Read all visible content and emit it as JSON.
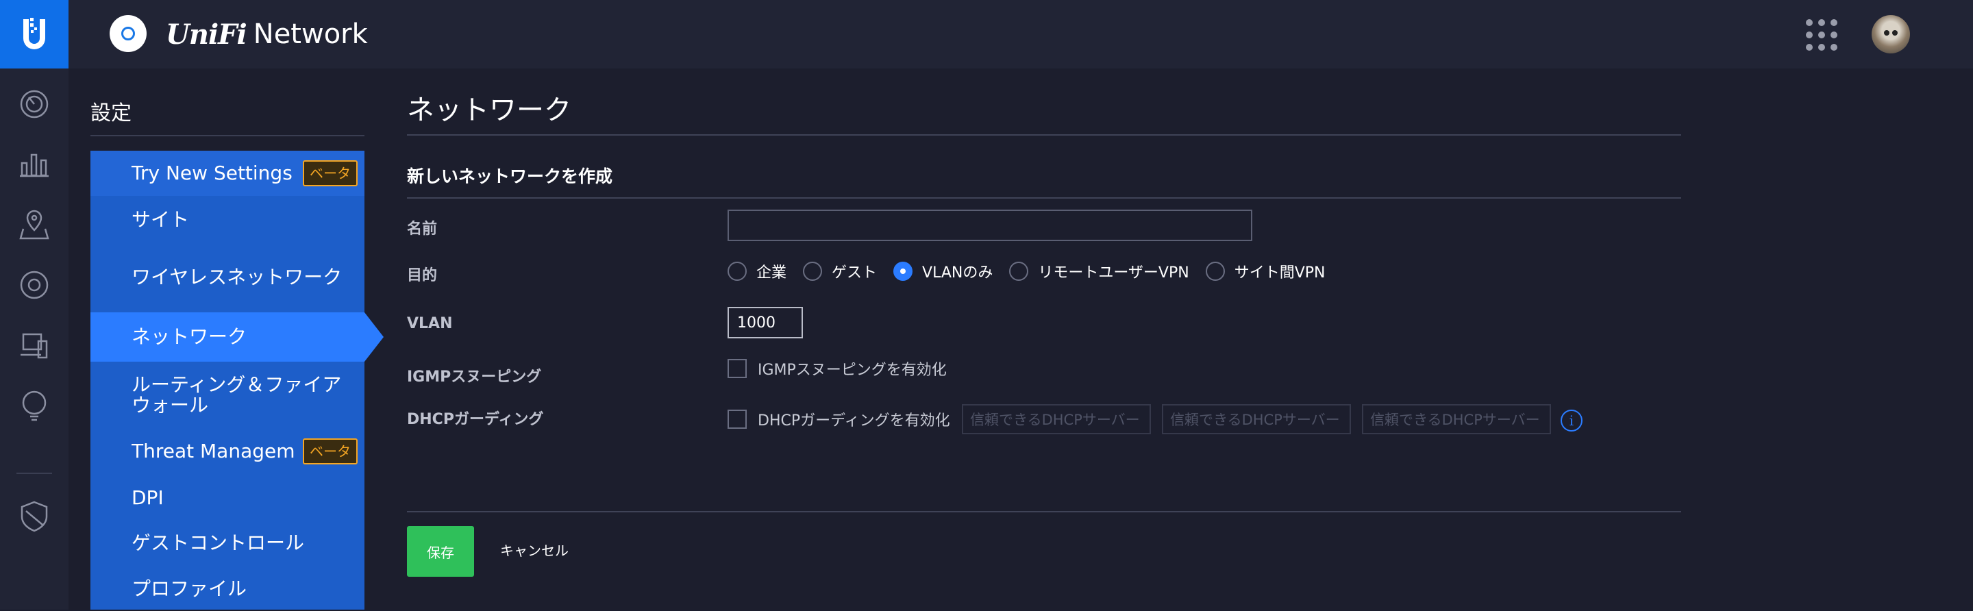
{
  "brand": {
    "name_stylized": "UniFi",
    "product": "Network"
  },
  "sidebar": {
    "title": "設定",
    "items": [
      {
        "label": "Try New Settings",
        "badge": "ベータ"
      },
      {
        "label": "サイト"
      },
      {
        "label": "ワイヤレスネットワーク"
      },
      {
        "label": "ネットワーク"
      },
      {
        "label": "ルーティング＆ファイアウォール"
      },
      {
        "label": "Threat Management",
        "badge": "ベータ"
      },
      {
        "label": "DPI"
      },
      {
        "label": "ゲストコントロール"
      },
      {
        "label": "プロファイル"
      }
    ]
  },
  "main": {
    "page_title": "ネットワーク",
    "section_title": "新しいネットワークを作成",
    "fields": {
      "name": {
        "label": "名前",
        "value": ""
      },
      "purpose": {
        "label": "目的",
        "options": [
          "企業",
          "ゲスト",
          "VLANのみ",
          "リモートユーザーVPN",
          "サイト間VPN"
        ],
        "selected": "VLANのみ"
      },
      "vlan": {
        "label": "VLAN",
        "value": "1000"
      },
      "igmp": {
        "label": "IGMPスヌーピング",
        "checkbox_label": "IGMPスヌーピングを有効化"
      },
      "dhcp_guard": {
        "label": "DHCPガーディング",
        "checkbox_label": "DHCPガーディングを有効化",
        "server_placeholder": "信頼できるDHCPサーバー"
      }
    },
    "save_label": "保存",
    "cancel_label": "キャンセル"
  },
  "colors": {
    "accent": "#2b7cff",
    "save": "#2fc05a",
    "beta_badge": "#f5a623",
    "background": "#1c1e2d",
    "menu": "#1d5ec9"
  },
  "icons": [
    "unifi-logo-icon",
    "app-network-icon",
    "dashboard-icon",
    "statistics-icon",
    "map-icon",
    "devices-icon",
    "clients-icon",
    "insights-icon",
    "events-icon",
    "alerts-icon",
    "apps-grid-icon",
    "info-icon"
  ]
}
